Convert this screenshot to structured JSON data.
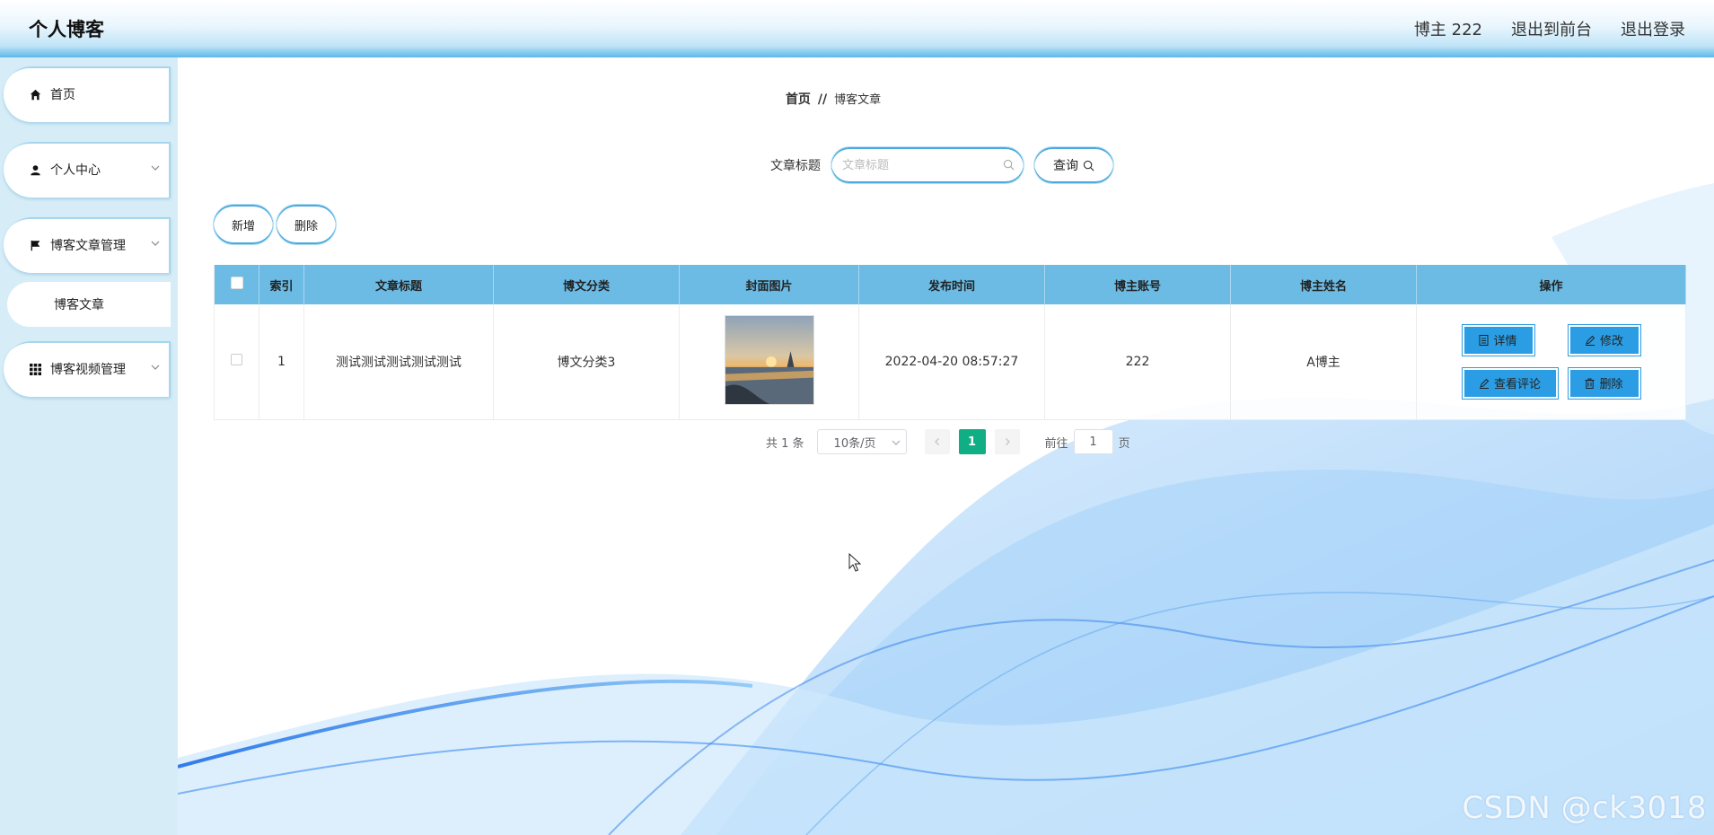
{
  "header": {
    "app_title": "个人博客",
    "user": "博主 222",
    "exit_front": "退出到前台",
    "logout": "退出登录"
  },
  "sidebar": {
    "items": [
      {
        "label": "首页",
        "icon": "home-icon"
      },
      {
        "label": "个人中心",
        "icon": "user-icon"
      },
      {
        "label": "博客文章管理",
        "icon": "flag-icon"
      },
      {
        "label": "博客文章",
        "icon": ""
      },
      {
        "label": "博客视频管理",
        "icon": "grid-icon"
      }
    ]
  },
  "breadcrumb": {
    "home": "首页",
    "separator": "//",
    "current": "博客文章"
  },
  "search": {
    "label": "文章标题",
    "placeholder": "文章标题",
    "button": "查询"
  },
  "actions": {
    "add": "新增",
    "delete": "删除"
  },
  "table": {
    "headers": [
      "索引",
      "文章标题",
      "博文分类",
      "封面图片",
      "发布时间",
      "博主账号",
      "博主姓名",
      "操作"
    ],
    "rows": [
      {
        "index": "1",
        "title": "测试测试测试测试测试",
        "category": "博文分类3",
        "publish_time": "2022-04-20 08:57:27",
        "account": "222",
        "name": "A博主",
        "ops": {
          "detail": "详情",
          "edit": "修改",
          "comments": "查看评论",
          "delete": "删除"
        }
      }
    ]
  },
  "pagination": {
    "total": "共 1 条",
    "page_size": "10条/页",
    "current_page": "1",
    "goto_label": "前往",
    "goto_value": "1",
    "goto_suffix": "页"
  },
  "watermark": "CSDN @ck3018",
  "colors": {
    "header_accent": "#5db8ea",
    "sidebar_bg": "#d6edf7",
    "table_header": "#6bbbe5",
    "op_button": "#2b9de4",
    "active_page": "#0fae84"
  }
}
